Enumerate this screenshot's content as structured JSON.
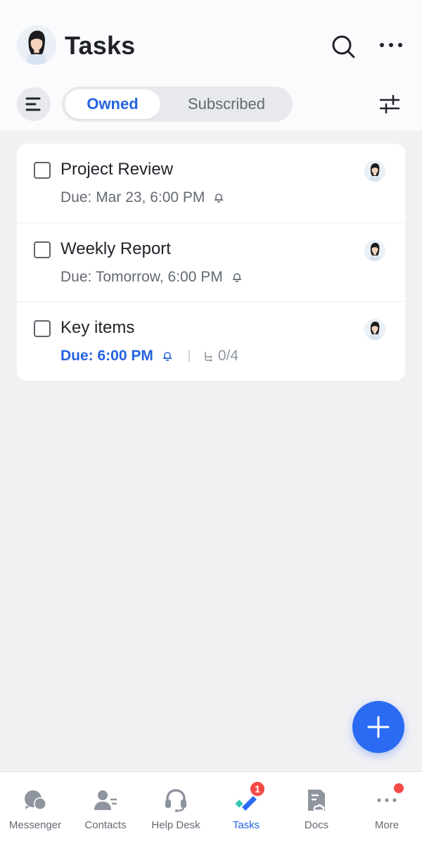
{
  "header": {
    "title": "Tasks",
    "search_icon": "search-icon",
    "more_icon": "ellipsis-icon"
  },
  "toolbar": {
    "menu_icon": "list-menu-icon",
    "tabs": [
      {
        "label": "Owned",
        "active": true
      },
      {
        "label": "Subscribed",
        "active": false
      }
    ],
    "filter_icon": "filter-sliders-icon"
  },
  "tasks": [
    {
      "title": "Project Review",
      "due": "Due: Mar 23, 6:00 PM",
      "reminder": true,
      "highlight": false
    },
    {
      "title": "Weekly Report",
      "due": "Due: Tomorrow, 6:00 PM",
      "reminder": true,
      "highlight": false
    },
    {
      "title": "Key items",
      "due": "Due: 6:00 PM",
      "reminder": true,
      "highlight": true,
      "subtasks": "0/4"
    }
  ],
  "fab": {
    "icon": "plus-icon"
  },
  "tabbar": {
    "items": [
      {
        "label": "Messenger",
        "icon": "messenger-icon"
      },
      {
        "label": "Contacts",
        "icon": "contacts-icon"
      },
      {
        "label": "Help Desk",
        "icon": "headset-icon"
      },
      {
        "label": "Tasks",
        "icon": "tasks-icon",
        "badge": "1",
        "active": true
      },
      {
        "label": "Docs",
        "icon": "docs-icon"
      },
      {
        "label": "More",
        "icon": "more-icon",
        "dot": true
      }
    ]
  },
  "colors": {
    "accent": "#2563e0",
    "fab": "#2b6bf3",
    "badge": "#f54a45"
  }
}
